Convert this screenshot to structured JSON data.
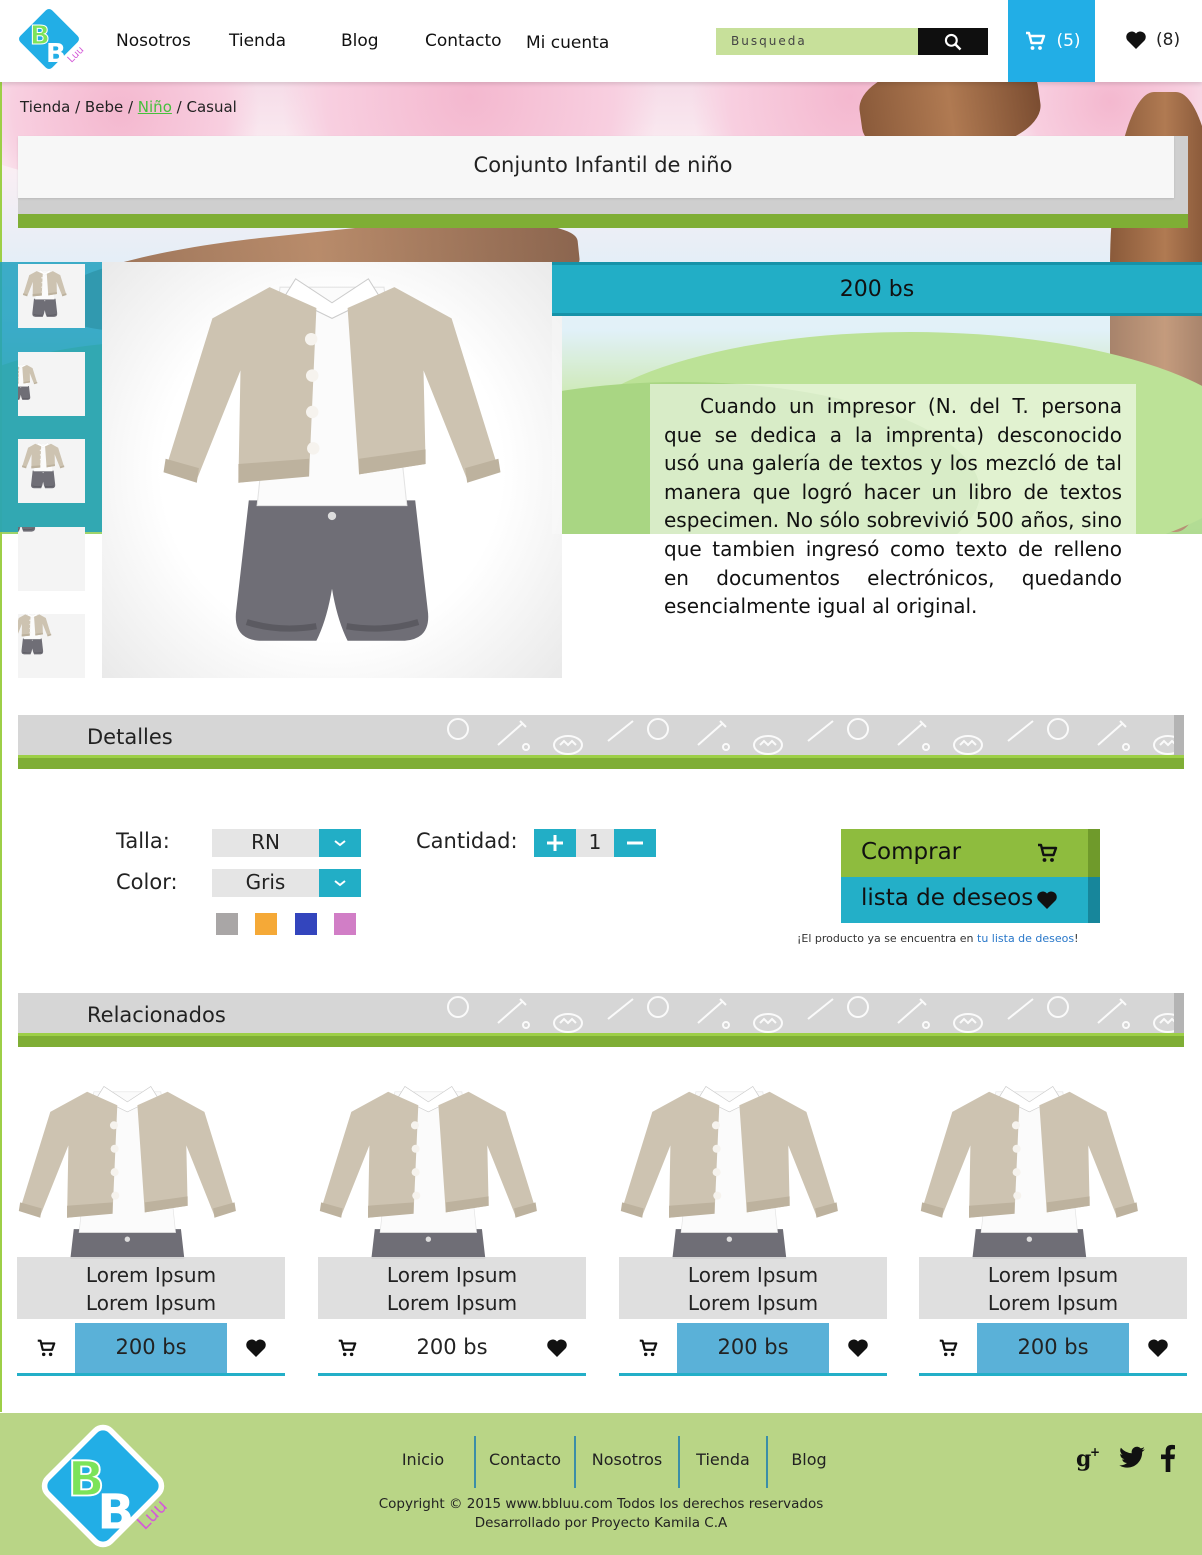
{
  "header": {
    "nav": [
      "Nosotros",
      "Tienda",
      "Blog",
      "Contacto",
      "Mi cuenta"
    ],
    "search_placeholder": "Busqueda",
    "cart_count": "(5)",
    "wishlist_count": "(8)",
    "logo_text": "BBLuu"
  },
  "breadcrumb": {
    "items": [
      "Tienda",
      "Bebe",
      "Niño",
      "Casual"
    ],
    "separator": " / ",
    "active_index": 2
  },
  "product": {
    "title": "Conjunto Infantil de niño",
    "price": "200 bs",
    "description": "Cuando un impresor (N. del T. persona que se dedica a la imprenta) desconocido usó una galería de textos y los mezcló de tal manera que logró hacer un libro de textos especimen. No sólo sobrevivió 500 años, sino que tambien ingresó como texto de relleno en documentos electrónicos, quedando esencialmente igual al original."
  },
  "details": {
    "section_title": "Detalles",
    "size_label": "Talla:",
    "size_value": "RN",
    "color_label": "Color:",
    "color_value": "Gris",
    "swatches": [
      "#a9a6a6",
      "#f5a937",
      "#3345bd",
      "#d17ec6"
    ],
    "quantity_label": "Cantidad:",
    "quantity_value": "1",
    "buy_label": "Comprar",
    "wishlist_label": "lista de deseos",
    "note_prefix": "¡El producto ya se encuentra en ",
    "note_link": "tu lista de deseos",
    "note_suffix": "!"
  },
  "related": {
    "section_title": "Relacionados",
    "items": [
      {
        "line1": "Lorem Ipsum",
        "line2": "Lorem Ipsum",
        "price": "200 bs",
        "highlight": true
      },
      {
        "line1": "Lorem Ipsum",
        "line2": "Lorem Ipsum",
        "price": "200 bs",
        "highlight": false
      },
      {
        "line1": "Lorem Ipsum",
        "line2": "Lorem Ipsum",
        "price": "200 bs",
        "highlight": true
      },
      {
        "line1": "Lorem Ipsum",
        "line2": "Lorem Ipsum",
        "price": "200 bs",
        "highlight": true
      }
    ]
  },
  "footer": {
    "links": [
      "Inicio",
      "Contacto",
      "Nosotros",
      "Tienda",
      "Blog"
    ],
    "copyright": "Copyright © 2015 www.bbluu.com Todos los derechos reservados",
    "developer": "Desarrollado por Proyecto Kamila C.A",
    "social": [
      "google-plus-icon",
      "twitter-icon",
      "facebook-icon"
    ]
  },
  "colors": {
    "accent_blue": "#22aec6",
    "accent_green": "#7fae35",
    "cart_blue": "#22aee6",
    "footer_green": "#b9d586"
  }
}
